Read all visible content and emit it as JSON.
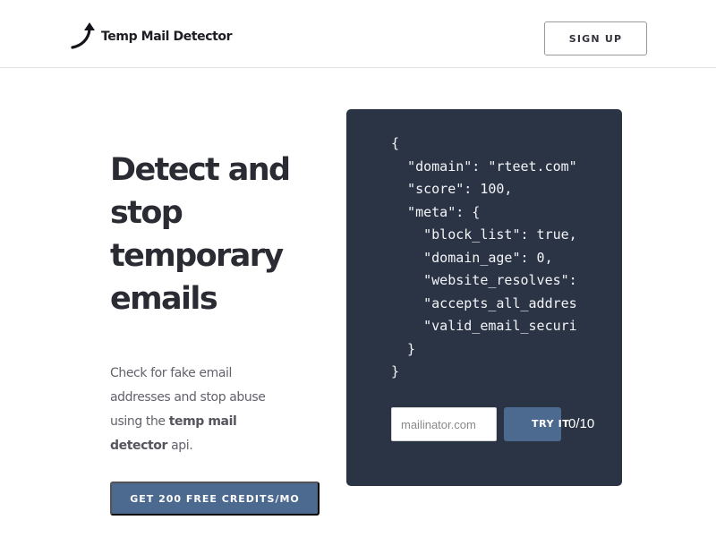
{
  "header": {
    "brand": "Temp Mail Detector",
    "signup_label": "SIGN UP"
  },
  "hero": {
    "title": "Detect and stop temporary emails",
    "description_parts": {
      "before": "Check for fake email addresses and stop abuse using the ",
      "bold": "temp mail detector",
      "after": " api."
    },
    "cta_label": "GET 200 FREE CREDITS/MO"
  },
  "demo": {
    "code_lines": [
      "{",
      "  \"domain\": \"rteet.com\"",
      "  \"score\": 100,",
      "  \"meta\": {",
      "    \"block_list\": true,",
      "    \"domain_age\": 0,",
      "    \"website_resolves\":",
      "    \"accepts_all_addres",
      "    \"valid_email_securi",
      "  }",
      "}"
    ],
    "input_placeholder": "mailinator.com",
    "try_label": "TRY IT",
    "counter": "0/10"
  },
  "colors": {
    "accent": "#4c6a8f",
    "code_background": "#2a3445"
  },
  "icons": {
    "logo": "curved-arrow-up-icon"
  }
}
